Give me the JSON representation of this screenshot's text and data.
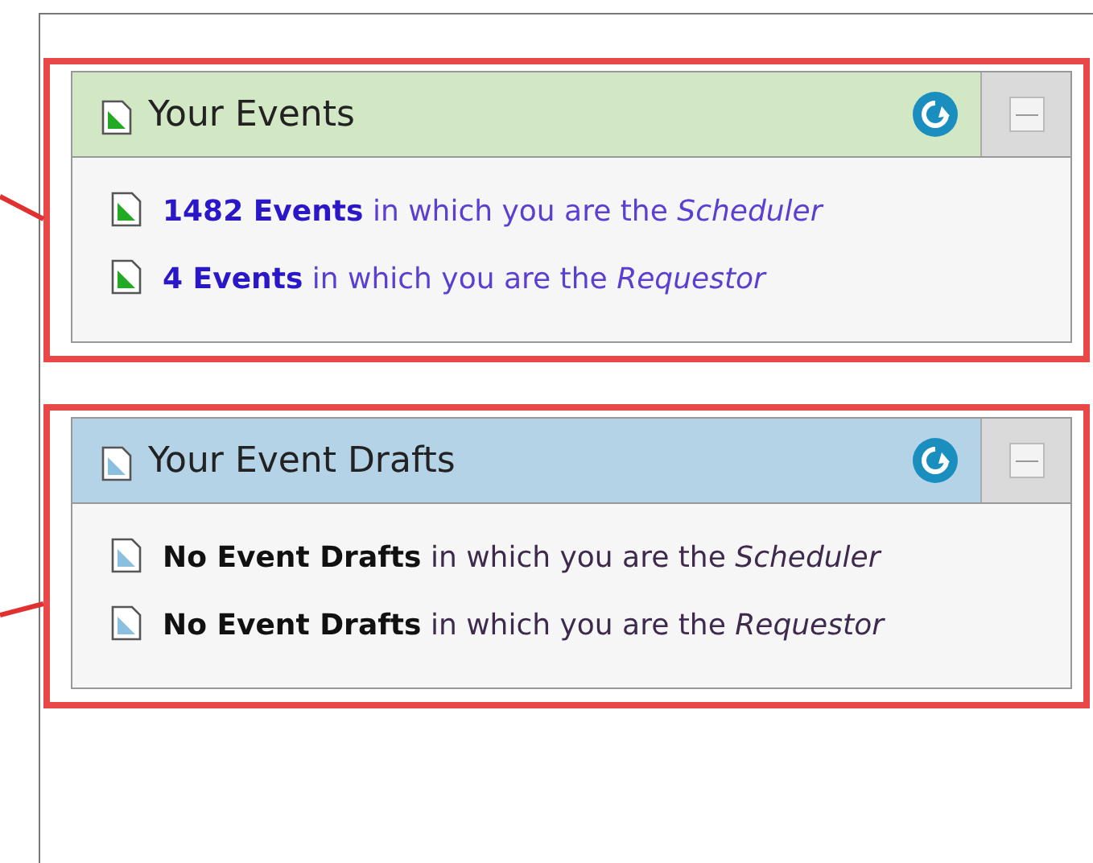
{
  "panels": [
    {
      "kind": "events",
      "title": "Your Events",
      "items": [
        {
          "text": "**1482 Events** in which you are the *Scheduler*"
        },
        {
          "text": "**4 Events** in which you are the *Requestor*"
        }
      ]
    },
    {
      "kind": "drafts",
      "title": "Your Event Drafts",
      "items": [
        {
          "text": "**No Event Drafts** in which you are the *Scheduler*"
        },
        {
          "text": "**No Event Drafts** in which you are the *Requestor*"
        }
      ]
    }
  ]
}
